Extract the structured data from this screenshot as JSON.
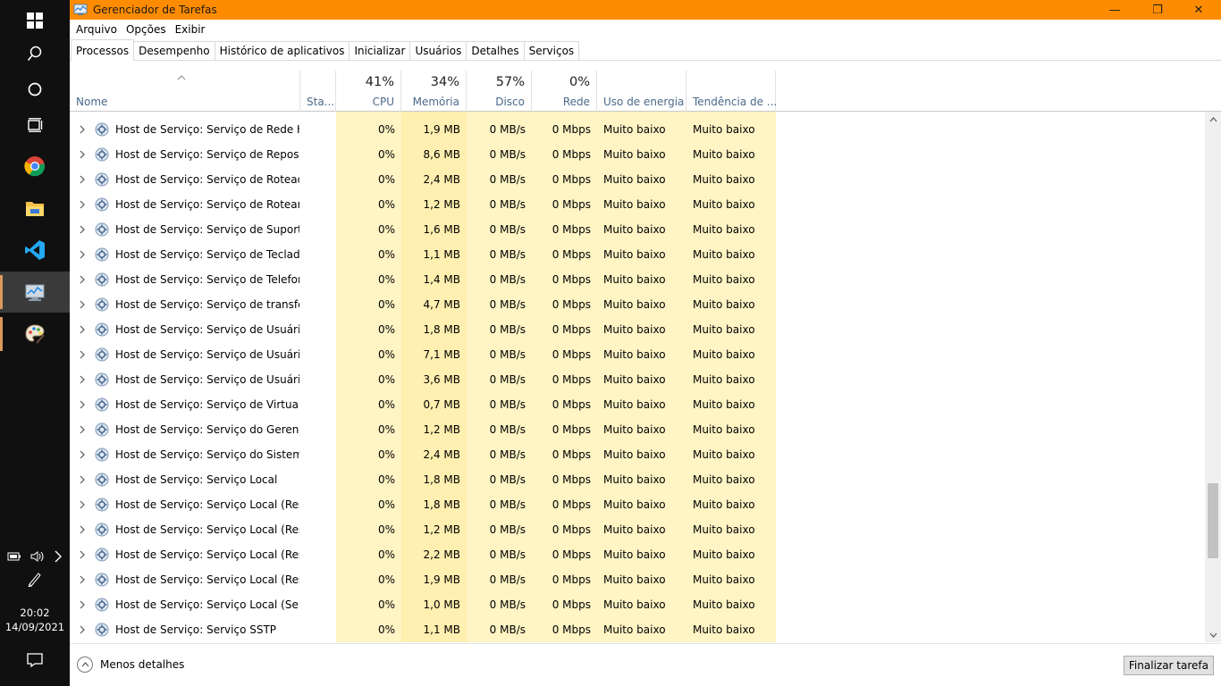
{
  "window": {
    "title": "Gerenciador de Tarefas",
    "accent": "#ff8c00"
  },
  "window_controls": {
    "minimize": "—",
    "restore": "❐",
    "close": "✕"
  },
  "menu": [
    "Arquivo",
    "Opções",
    "Exibir"
  ],
  "tabs": [
    "Processos",
    "Desempenho",
    "Histórico de aplicativos",
    "Inicializar",
    "Usuários",
    "Detalhes",
    "Serviços"
  ],
  "active_tab": "Processos",
  "header": {
    "name": "Nome",
    "status": "Sta...",
    "cpu": {
      "pct": "41%",
      "label": "CPU"
    },
    "memory": {
      "pct": "34%",
      "label": "Memória"
    },
    "disk": {
      "pct": "57%",
      "label": "Disco"
    },
    "network": {
      "pct": "0%",
      "label": "Rede"
    },
    "power": "Uso de energia",
    "power_trend": "Tendência de ..."
  },
  "rows": [
    {
      "name": "Host de Serviço: Serviço de Rede Host",
      "cpu": "0%",
      "mem": "1,9 MB",
      "disk": "0 MB/s",
      "net": "0 Mbps",
      "power": "Muito baixo",
      "trend": "Muito baixo"
    },
    {
      "name": "Host de Serviço: Serviço de Repositó...",
      "cpu": "0%",
      "mem": "8,6 MB",
      "disk": "0 MB/s",
      "net": "0 Mbps",
      "power": "Muito baixo",
      "trend": "Muito baixo"
    },
    {
      "name": "Host de Serviço: Serviço de Roteador...",
      "cpu": "0%",
      "mem": "2,4 MB",
      "disk": "0 MB/s",
      "net": "0 Mbps",
      "power": "Muito baixo",
      "trend": "Muito baixo"
    },
    {
      "name": "Host de Serviço: Serviço de Roteame...",
      "cpu": "0%",
      "mem": "1,2 MB",
      "disk": "0 MB/s",
      "net": "0 Mbps",
      "power": "Muito baixo",
      "trend": "Muito baixo"
    },
    {
      "name": "Host de Serviço: Serviço de Suporte ...",
      "cpu": "0%",
      "mem": "1,6 MB",
      "disk": "0 MB/s",
      "net": "0 Mbps",
      "power": "Muito baixo",
      "trend": "Muito baixo"
    },
    {
      "name": "Host de Serviço: Serviço de Teclado ...",
      "cpu": "0%",
      "mem": "1,1 MB",
      "disk": "0 MB/s",
      "net": "0 Mbps",
      "power": "Muito baixo",
      "trend": "Muito baixo"
    },
    {
      "name": "Host de Serviço: Serviço de Telefonia",
      "cpu": "0%",
      "mem": "1,4 MB",
      "disk": "0 MB/s",
      "net": "0 Mbps",
      "power": "Muito baixo",
      "trend": "Muito baixo"
    },
    {
      "name": "Host de Serviço: Serviço de transferê...",
      "cpu": "0%",
      "mem": "4,7 MB",
      "disk": "0 MB/s",
      "net": "0 Mbps",
      "power": "Muito baixo",
      "trend": "Muito baixo"
    },
    {
      "name": "Host de Serviço: Serviço de Usuário ...",
      "cpu": "0%",
      "mem": "1,8 MB",
      "disk": "0 MB/s",
      "net": "0 Mbps",
      "power": "Muito baixo",
      "trend": "Muito baixo"
    },
    {
      "name": "Host de Serviço: Serviço de Usuário ...",
      "cpu": "0%",
      "mem": "7,1 MB",
      "disk": "0 MB/s",
      "net": "0 Mbps",
      "power": "Muito baixo",
      "trend": "Muito baixo"
    },
    {
      "name": "Host de Serviço: Serviço de Usuário ...",
      "cpu": "0%",
      "mem": "3,6 MB",
      "disk": "0 MB/s",
      "net": "0 Mbps",
      "power": "Muito baixo",
      "trend": "Muito baixo"
    },
    {
      "name": "Host de Serviço: Serviço de Virtualiza...",
      "cpu": "0%",
      "mem": "0,7 MB",
      "disk": "0 MB/s",
      "net": "0 Mbps",
      "power": "Muito baixo",
      "trend": "Muito baixo"
    },
    {
      "name": "Host de Serviço: Serviço do Gerencia...",
      "cpu": "0%",
      "mem": "1,2 MB",
      "disk": "0 MB/s",
      "net": "0 Mbps",
      "power": "Muito baixo",
      "trend": "Muito baixo"
    },
    {
      "name": "Host de Serviço: Serviço do Sistema ...",
      "cpu": "0%",
      "mem": "2,4 MB",
      "disk": "0 MB/s",
      "net": "0 Mbps",
      "power": "Muito baixo",
      "trend": "Muito baixo"
    },
    {
      "name": "Host de Serviço: Serviço Local",
      "cpu": "0%",
      "mem": "1,8 MB",
      "disk": "0 MB/s",
      "net": "0 Mbps",
      "power": "Muito baixo",
      "trend": "Muito baixo"
    },
    {
      "name": "Host de Serviço: Serviço Local (Restri...",
      "cpu": "0%",
      "mem": "1,8 MB",
      "disk": "0 MB/s",
      "net": "0 Mbps",
      "power": "Muito baixo",
      "trend": "Muito baixo"
    },
    {
      "name": "Host de Serviço: Serviço Local (Restri...",
      "cpu": "0%",
      "mem": "1,2 MB",
      "disk": "0 MB/s",
      "net": "0 Mbps",
      "power": "Muito baixo",
      "trend": "Muito baixo"
    },
    {
      "name": "Host de Serviço: Serviço Local (Restri...",
      "cpu": "0%",
      "mem": "2,2 MB",
      "disk": "0 MB/s",
      "net": "0 Mbps",
      "power": "Muito baixo",
      "trend": "Muito baixo"
    },
    {
      "name": "Host de Serviço: Serviço Local (Restri...",
      "cpu": "0%",
      "mem": "1,9 MB",
      "disk": "0 MB/s",
      "net": "0 Mbps",
      "power": "Muito baixo",
      "trend": "Muito baixo"
    },
    {
      "name": "Host de Serviço: Serviço Local (Sem ...",
      "cpu": "0%",
      "mem": "1,0 MB",
      "disk": "0 MB/s",
      "net": "0 Mbps",
      "power": "Muito baixo",
      "trend": "Muito baixo"
    },
    {
      "name": "Host de Serviço: Serviço SSTP",
      "cpu": "0%",
      "mem": "1,1 MB",
      "disk": "0 MB/s",
      "net": "0 Mbps",
      "power": "Muito baixo",
      "trend": "Muito baixo"
    }
  ],
  "heat_colors": {
    "light": "#fff4c4",
    "medium": "#ffefb0"
  },
  "footer": {
    "less_details": "Menos detalhes",
    "end_task": "Finalizar tarefa"
  },
  "taskbar": {
    "icons": [
      "windows-start-icon",
      "search-icon",
      "cortana-icon",
      "task-view-icon",
      "chrome-icon",
      "file-explorer-icon",
      "vscode-icon",
      "task-manager-icon",
      "paint-icon"
    ],
    "clock_time": "20:02",
    "clock_date": "14/09/2021"
  }
}
